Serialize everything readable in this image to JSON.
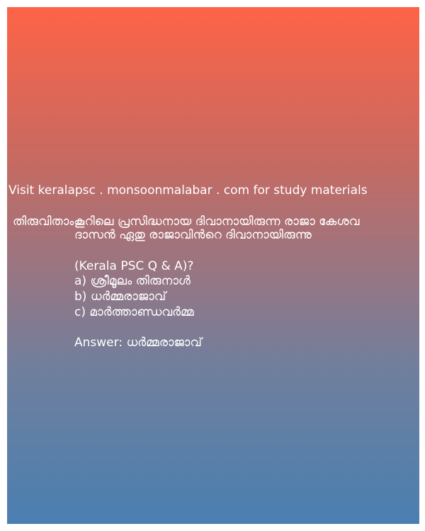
{
  "header": {
    "visit_text": "Visit keralapsc . monsoonmalabar . com for study materials"
  },
  "question": {
    "line1": "തിരുവിതാംകൂറിലെ പ്രസിദ്ധനായ ദിവാനായിരുന്ന രാജാ കേശവ",
    "line2": "ദാസൻ ഏതു രാജാവിൻറെ ദിവാനായിരുന്നു",
    "line3": "(Kerala PSC Q & A)?"
  },
  "options": [
    {
      "label": "a) ശ്രീമൂലം തിരുനാൾ"
    },
    {
      "label": "b) ധർമ്മരാജാവ്"
    },
    {
      "label": "c) മാർത്താണ്ഡവർമ്മ"
    }
  ],
  "answer": {
    "text": "Answer: ധർമ്മരാജാവ്"
  }
}
